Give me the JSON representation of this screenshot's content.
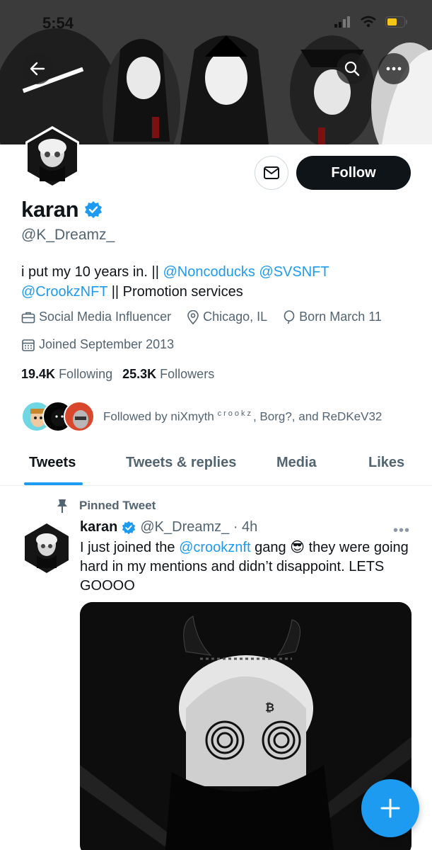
{
  "status_bar": {
    "time": "5:54"
  },
  "profile": {
    "display_name": "karan",
    "handle": "@K_Dreamz_",
    "follow_label": "Follow",
    "bio": {
      "prefix": "i put my 10 years in. || ",
      "mention1": "@Noncoducks",
      "mention2": "@SVSNFT",
      "mention3": "@CrookzNFT",
      "suffix": " || Promotion services"
    },
    "category": "Social Media Influencer",
    "location": "Chicago, IL",
    "birthday": "Born March 11",
    "joined": "Joined September 2013",
    "following_count": "19.4K",
    "following_label": "Following",
    "followers_count": "25.3K",
    "followers_label": "Followers",
    "followed_by_prefix": "Followed by niXmyth ",
    "followed_by_super": "crookz",
    "followed_by_suffix": ", Borg?, and ReDKeV32"
  },
  "tabs": [
    "Tweets",
    "Tweets & replies",
    "Media",
    "Likes"
  ],
  "pinned_tweet": {
    "pinned_label": "Pinned Tweet",
    "author": "karan",
    "handle_time": "@K_Dreamz_ · 4h",
    "more": "•••",
    "text_before": "I just joined the ",
    "mention": "@crookznft",
    "text_mid": " gang ",
    "emoji": "😎",
    "text_after": " they were going hard in my mentions and didn’t disappoint. LETS GOOOO"
  },
  "colors": {
    "accent": "#1d9bf0",
    "text": "#0f1419",
    "muted": "#536471"
  },
  "icons": [
    "back-arrow-icon",
    "search-icon",
    "more-icon",
    "mail-icon",
    "verified-icon",
    "briefcase-icon",
    "location-icon",
    "balloon-icon",
    "calendar-icon",
    "pin-icon",
    "compose-plus-icon"
  ]
}
